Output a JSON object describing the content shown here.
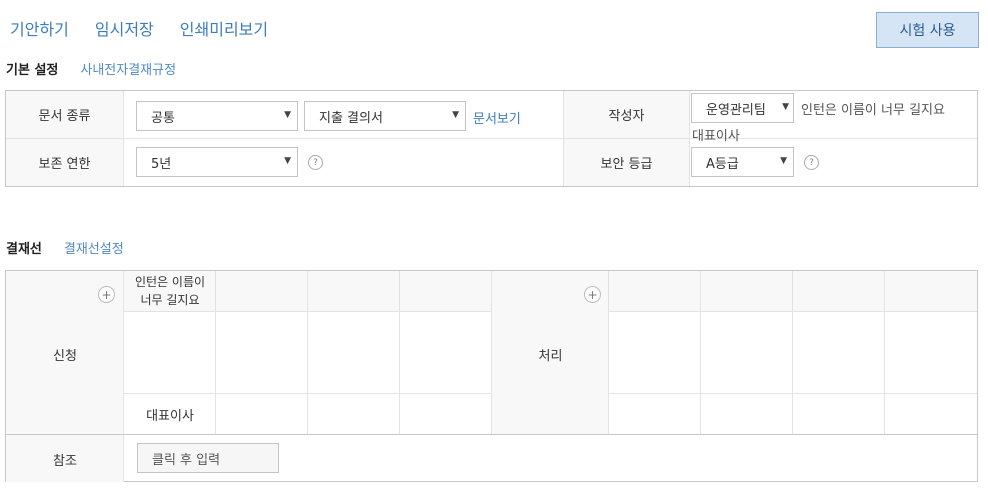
{
  "toolbar": {
    "draft": "기안하기",
    "save_temp": "임시저장",
    "print_preview": "인쇄미리보기",
    "trial": "시험 사용"
  },
  "basic_settings": {
    "title": "기본 설정",
    "rules_link": "사내전자결재규정",
    "doc_type_label": "문서 종류",
    "doc_category": "공통",
    "doc_form": "지출 결의서",
    "view_doc_link": "문서보기",
    "author_label": "작성자",
    "author_dept": "운영관리팀",
    "author_name": "인턴은 이름이 너무 길지요",
    "author_title": "대표이사",
    "retention_label": "보존 연한",
    "retention_value": "5년",
    "security_label": "보안 등급",
    "security_value": "A등급",
    "help": "?"
  },
  "approval_line": {
    "title": "결재선",
    "settings_link": "결재선설정",
    "apply_label": "신청",
    "process_label": "처리",
    "reference_label": "참조",
    "approver_name_line1": "인턴은 이름이",
    "approver_name_line2": "너무 길지요",
    "approver_title": "대표이사",
    "reference_placeholder": "클릭 후 입력",
    "plus": "+"
  },
  "arrow_glyph": "▼"
}
